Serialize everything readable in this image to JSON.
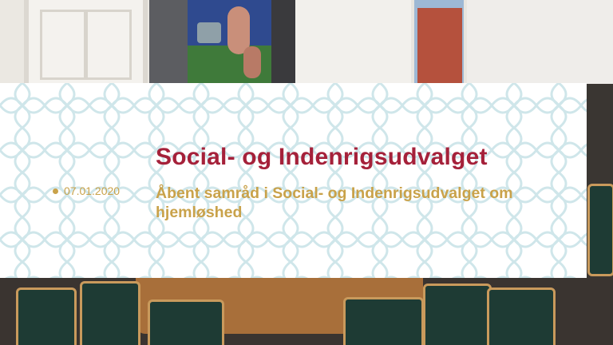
{
  "banner": {
    "committee_title": "Social- og Indenrigsudvalget",
    "date": "07.01.2020",
    "session_subtitle": "Åbent samråd i Social- og Indenrigsudvalget om hjemløshed"
  },
  "colors": {
    "title": "#a5213a",
    "accent": "#c9a24a",
    "pattern": "#cfe6ea"
  }
}
